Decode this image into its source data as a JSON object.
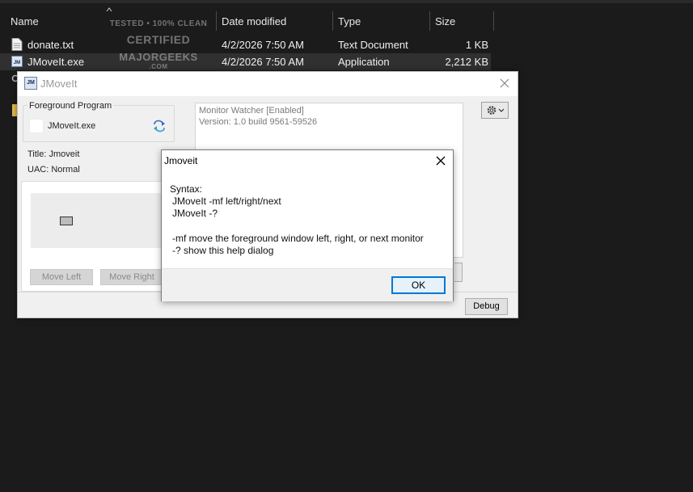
{
  "explorer": {
    "columns": {
      "name": "Name",
      "date_modified": "Date modified",
      "type": "Type",
      "size": "Size"
    },
    "files": [
      {
        "name": "donate.txt",
        "date": "4/2/2026 7:50 AM",
        "type": "Text Document",
        "size": "1 KB",
        "icon": "text-document-icon"
      },
      {
        "name": "JMoveIt.exe",
        "date": "4/2/2026 7:50 AM",
        "type": "Application",
        "size": "2,212 KB",
        "icon": "application-icon",
        "selected": true
      }
    ],
    "watermark": {
      "line1": "TESTED • 100% CLEAN",
      "line2": "CERTIFIED",
      "line3": "MAJORGEEKS",
      "line4": ".COM"
    }
  },
  "main_window": {
    "title": "JMoveIt",
    "app_icon_text": "JM",
    "foreground_group_label": "Foreground Program",
    "foreground_exe": "JMoveIt.exe",
    "title_line": "Title: Jmoveit",
    "uac_line": "UAC: Normal",
    "move_left_label": "Move Left",
    "move_right_label": "Move Right",
    "status_lines": [
      "Monitor Watcher [Enabled]",
      "Version: 1.0 build 9561-59526"
    ],
    "debug_label": "Debug"
  },
  "help_dialog": {
    "title": "Jmoveit",
    "lines": [
      "Syntax:",
      "JMoveIt -mf left/right/next",
      "JMoveIt -?",
      "-mf move the foreground window left, right, or next monitor",
      "-? show this help dialog"
    ],
    "ok_label": "OK"
  },
  "colors": {
    "explorer_bg": "#1b1b1b",
    "window_bg": "#f0f0f0",
    "accent_focus": "#0078d7"
  }
}
